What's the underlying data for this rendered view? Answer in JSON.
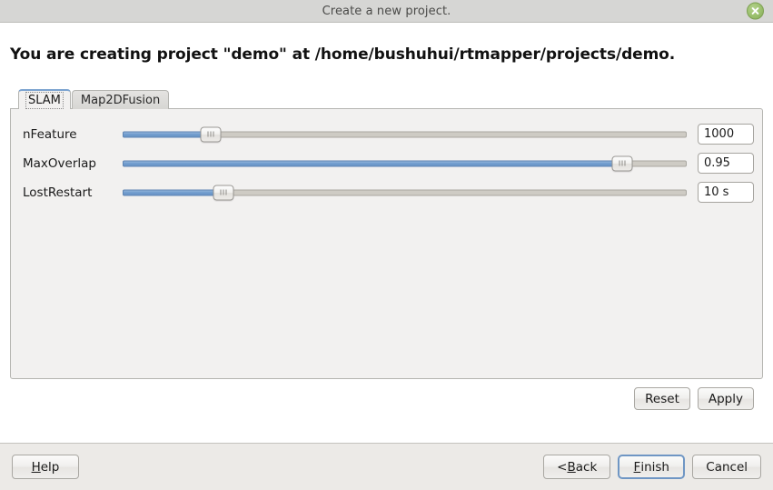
{
  "window": {
    "title": "Create a new project.",
    "close_icon": "close-icon"
  },
  "headline": "You are creating project \"demo\" at /home/bushuhui/rtmapper/projects/demo.",
  "tabs": [
    {
      "label": "SLAM",
      "active": true
    },
    {
      "label": "Map2DFusion",
      "active": false
    }
  ],
  "settings": {
    "rows": [
      {
        "label": "nFeature",
        "value": "1000",
        "slider_percent": 15.6
      },
      {
        "label": "MaxOverlap",
        "value": "0.95",
        "slider_percent": 88.6
      },
      {
        "label": "LostRestart",
        "value": "10 s",
        "slider_percent": 17.9
      }
    ]
  },
  "panel_actions": {
    "reset_label": "Reset",
    "apply_label": "Apply"
  },
  "footer": {
    "help": {
      "pre": "",
      "mnemonic": "H",
      "post": "elp"
    },
    "back": {
      "pre": "< ",
      "mnemonic": "B",
      "post": "ack"
    },
    "finish": {
      "pre": "",
      "mnemonic": "F",
      "post": "inish"
    },
    "cancel_label": "Cancel"
  },
  "colors": {
    "titlebar_bg": "#d6d6d4",
    "panel_bg": "#f2f1f0",
    "footer_bg": "#eceae7",
    "slider_fill": "#6f9bcd",
    "slider_groove": "#cecbc4",
    "default_button_border": "#6f96c4",
    "close_button": "#9bc06d"
  }
}
